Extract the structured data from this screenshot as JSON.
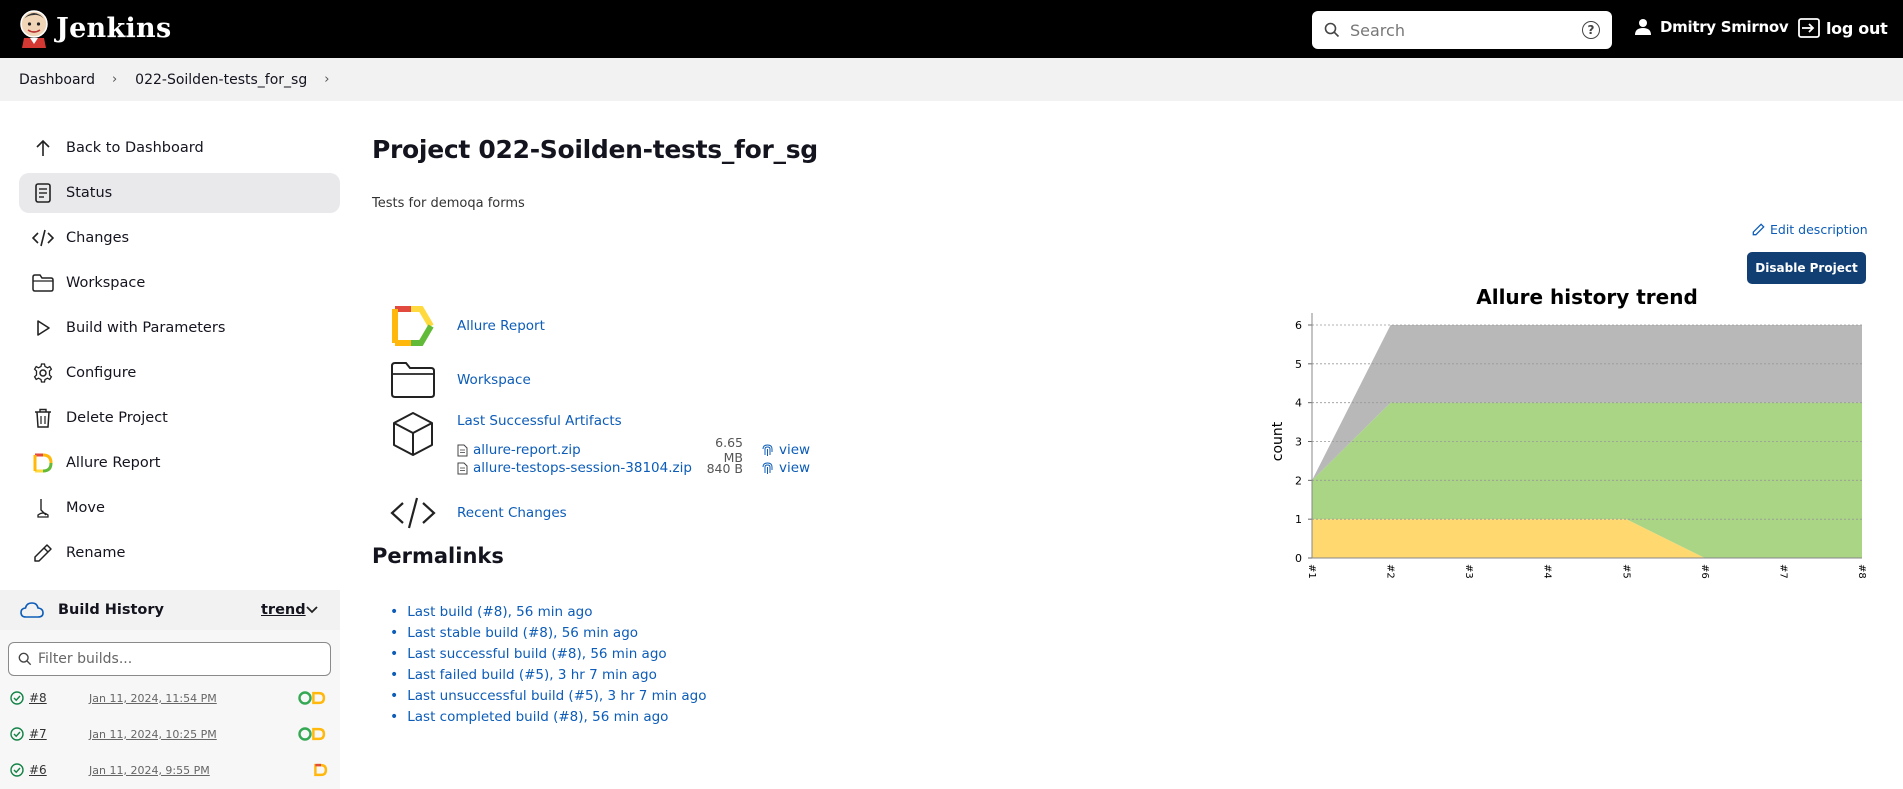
{
  "header": {
    "app_name": "Jenkins",
    "search_placeholder": "Search",
    "help_label": "?",
    "user_name": "Dmitry Smirnov",
    "logout_label": "log out"
  },
  "breadcrumb": [
    "Dashboard",
    "022-Soilden-tests_for_sg"
  ],
  "sidebar": {
    "items": [
      {
        "label": "Back to Dashboard",
        "icon": "arrow-up-icon"
      },
      {
        "label": "Status",
        "icon": "document-icon",
        "active": true
      },
      {
        "label": "Changes",
        "icon": "code-icon"
      },
      {
        "label": "Workspace",
        "icon": "folder-icon"
      },
      {
        "label": "Build with Parameters",
        "icon": "play-icon"
      },
      {
        "label": "Configure",
        "icon": "gear-icon"
      },
      {
        "label": "Delete Project",
        "icon": "trash-icon"
      },
      {
        "label": "Allure Report",
        "icon": "allure-icon"
      },
      {
        "label": "Move",
        "icon": "move-icon"
      },
      {
        "label": "Rename",
        "icon": "pencil-icon"
      }
    ]
  },
  "build_history": {
    "title": "Build History",
    "trend_label": "trend",
    "filter_placeholder": "Filter builds...",
    "builds": [
      {
        "number": "#8",
        "date": "Jan 11, 2024, 11:54 PM"
      },
      {
        "number": "#7",
        "date": "Jan 11, 2024, 10:25 PM"
      },
      {
        "number": "#6",
        "date": "Jan 11, 2024, 9:55 PM"
      }
    ]
  },
  "main": {
    "title": "Project 022-Soilden-tests_for_sg",
    "description": "Tests for demoqa forms",
    "edit_description": "Edit description",
    "disable_button": "Disable Project",
    "links": {
      "allure": "Allure Report",
      "workspace": "Workspace",
      "artifacts": "Last Successful Artifacts",
      "recent_changes": "Recent Changes"
    },
    "artifacts": [
      {
        "name": "allure-report.zip",
        "size": "6.65 MB",
        "view": "view"
      },
      {
        "name": "allure-testops-session-38104.zip",
        "size": "840 B",
        "view": "view"
      }
    ],
    "permalinks_title": "Permalinks",
    "permalinks": [
      "Last build (#8), 56 min ago",
      "Last stable build (#8), 56 min ago",
      "Last successful build (#8), 56 min ago",
      "Last failed build (#5), 3 hr 7 min ago",
      "Last unsuccessful build (#5), 3 hr 7 min ago",
      "Last completed build (#8), 56 min ago"
    ]
  },
  "chart_data": {
    "type": "area",
    "title": "Allure history trend",
    "ylabel": "count",
    "xlabel": "",
    "x": [
      "#1",
      "#2",
      "#3",
      "#4",
      "#5",
      "#6",
      "#7",
      "#8"
    ],
    "ylim": [
      0,
      6
    ],
    "yticks": [
      0,
      1,
      2,
      3,
      4,
      5,
      6
    ],
    "stacked": true,
    "series": [
      {
        "color": "#ffd970",
        "values": [
          1,
          1,
          1,
          1,
          1,
          0,
          0,
          0
        ]
      },
      {
        "color": "#a9d584",
        "values": [
          1,
          3,
          3,
          3,
          3,
          4,
          4,
          4
        ]
      },
      {
        "color": "#b8b8b8",
        "values": [
          0,
          2,
          2,
          2,
          2,
          2,
          2,
          2
        ]
      }
    ]
  }
}
